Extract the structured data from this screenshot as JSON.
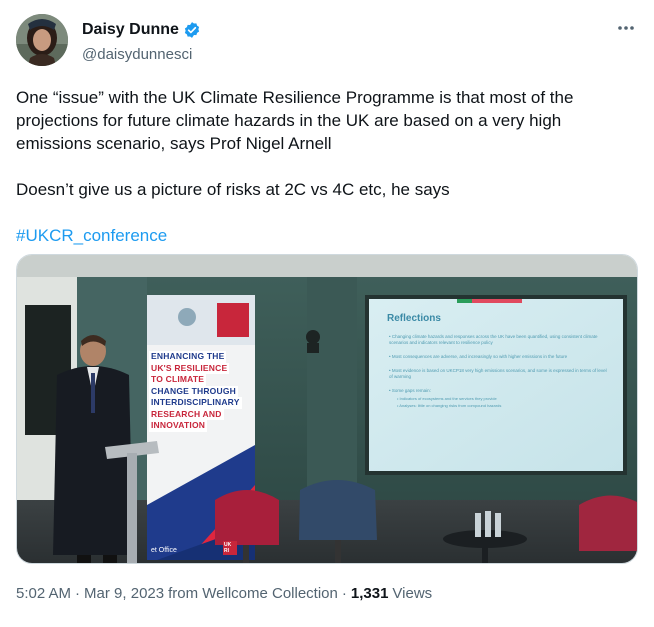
{
  "author": {
    "display_name": "Daisy Dunne",
    "handle": "@daisydunnesci",
    "verified": true,
    "avatar_icon": "profile-photo"
  },
  "tweet": {
    "paragraph_1": "One “issue” with the UK Climate Resilience Programme is that most of the projections for future climate hazards in the UK are based on a very high emissions scenario, says Prof Nigel Arnell",
    "paragraph_2": "Doesn’t give us a picture of risks at 2C vs 4C etc, he says",
    "hashtag": "#UKCR_conference"
  },
  "media": {
    "banner": {
      "lines": [
        "ENHANCING THE",
        "UK'S RESILIENCE",
        "TO CLIMATE",
        "CHANGE THROUGH",
        "INTERDISCIPLINARY",
        "RESEARCH AND",
        "INNOVATION"
      ],
      "footer_left": "et Office",
      "footer_logo": "UK RI"
    },
    "screen": {
      "title": "Reflections",
      "bullets": [
        "Changing climate hazards and responses across the UK have been quantified, using consistent climate scenarios and indicators relevant to resilience policy",
        "Most consequences are adverse, and increasingly so with higher emissions in the future",
        "Most evidence is based on UKCP18 very high emissions scenarios, and some is expressed in terms of level of warming",
        "Some gaps remain:",
        "Indicators of ecosystems and the services they provide",
        "Analyses: little on changing risks from compound hazards"
      ]
    }
  },
  "meta": {
    "time": "5:02 AM",
    "date": "Mar 9, 2023",
    "source": "from Wellcome Collection",
    "views_count": "1,331",
    "views_label": "Views",
    "separator": "·"
  },
  "colors": {
    "link": "#1d9bf0",
    "verified": "#1d9bf0",
    "secondary_text": "#536471"
  }
}
